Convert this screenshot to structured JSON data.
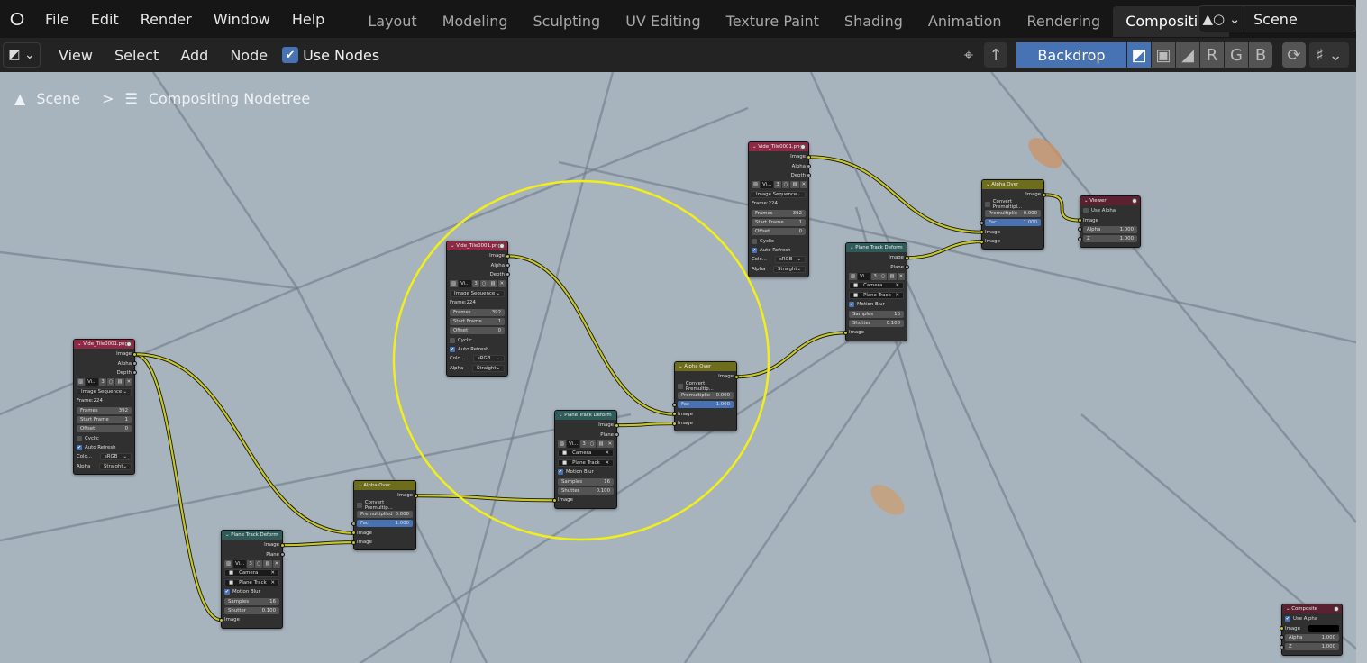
{
  "topbar": {
    "menus": [
      "File",
      "Edit",
      "Render",
      "Window",
      "Help"
    ],
    "workspaces": [
      "Layout",
      "Modeling",
      "Sculpting",
      "UV Editing",
      "Texture Paint",
      "Shading",
      "Animation",
      "Rendering",
      "Compositing"
    ],
    "active_workspace": "Compositing",
    "scene": "Scene"
  },
  "toolbar": {
    "menus": [
      "View",
      "Select",
      "Add",
      "Node"
    ],
    "use_nodes_label": "Use Nodes",
    "use_nodes_checked": true,
    "backdrop_label": "Backdrop",
    "channels": [
      "R",
      "G",
      "B"
    ]
  },
  "breadcrumb": {
    "scene": "Scene",
    "separator": ">",
    "nodetree": "Compositing Nodetree"
  },
  "colors": {
    "image_header": "#8c2a45",
    "alphaover_header": "#6d6d1c",
    "planetrack_header": "#2f5c5a",
    "output_header": "#5b2130",
    "link": "#c7c729",
    "annotation_circle": "#f2ee1a",
    "accent": "#4772b3"
  },
  "nodes": [
    {
      "id": "img1",
      "type": "image",
      "title": "Vide_Tile0001.png",
      "rows": [
        {
          "t": "out",
          "label": "Image",
          "s": "y"
        },
        {
          "t": "out",
          "label": "Alpha",
          "s": "g"
        },
        {
          "t": "out",
          "label": "Depth",
          "s": "g"
        },
        {
          "t": "imgbar",
          "name": "Vi...",
          "users": "3"
        },
        {
          "t": "select",
          "value": "Image Sequence"
        },
        {
          "t": "text",
          "label": "Frame:224"
        },
        {
          "t": "field",
          "label": "Frames",
          "value": "392"
        },
        {
          "t": "field",
          "label": "Start Frame",
          "value": "1"
        },
        {
          "t": "field",
          "label": "Offset",
          "value": "0"
        },
        {
          "t": "check",
          "label": "Cyclic",
          "checked": false
        },
        {
          "t": "check",
          "label": "Auto Refresh",
          "checked": true
        },
        {
          "t": "lselect",
          "label": "Colo...",
          "value": "sRGB"
        },
        {
          "t": "lselect",
          "label": "Alpha",
          "value": "Straight"
        }
      ]
    },
    {
      "id": "img2",
      "type": "image",
      "title": "Vide_Tile0001.png",
      "rows": [
        {
          "t": "out",
          "label": "Image",
          "s": "y"
        },
        {
          "t": "out",
          "label": "Alpha",
          "s": "g"
        },
        {
          "t": "out",
          "label": "Depth",
          "s": "g"
        },
        {
          "t": "imgbar",
          "name": "Vi...",
          "users": "3"
        },
        {
          "t": "select",
          "value": "Image Sequence"
        },
        {
          "t": "text",
          "label": "Frame:224"
        },
        {
          "t": "field",
          "label": "Frames",
          "value": "392"
        },
        {
          "t": "field",
          "label": "Start Frame",
          "value": "1"
        },
        {
          "t": "field",
          "label": "Offset",
          "value": "0"
        },
        {
          "t": "check",
          "label": "Cyclic",
          "checked": false
        },
        {
          "t": "check",
          "label": "Auto Refresh",
          "checked": true
        },
        {
          "t": "lselect",
          "label": "Colo...",
          "value": "sRGB"
        },
        {
          "t": "lselect",
          "label": "Alpha",
          "value": "Straight"
        }
      ]
    },
    {
      "id": "img3",
      "type": "image",
      "title": "Vide_Tile0001.png",
      "rows": [
        {
          "t": "out",
          "label": "Image",
          "s": "y"
        },
        {
          "t": "out",
          "label": "Alpha",
          "s": "g"
        },
        {
          "t": "out",
          "label": "Depth",
          "s": "g"
        },
        {
          "t": "imgbar",
          "name": "Vi...",
          "users": "3"
        },
        {
          "t": "select",
          "value": "Image Sequence"
        },
        {
          "t": "text",
          "label": "Frame:224"
        },
        {
          "t": "field",
          "label": "Frames",
          "value": "392"
        },
        {
          "t": "field",
          "label": "Start Frame",
          "value": "1"
        },
        {
          "t": "field",
          "label": "Offset",
          "value": "0"
        },
        {
          "t": "check",
          "label": "Cyclic",
          "checked": false
        },
        {
          "t": "check",
          "label": "Auto Refresh",
          "checked": true
        },
        {
          "t": "lselect",
          "label": "Colo...",
          "value": "sRGB"
        },
        {
          "t": "lselect",
          "label": "Alpha",
          "value": "Straight"
        }
      ]
    },
    {
      "id": "ptd1",
      "type": "planetrack",
      "title": "Plane Track Deform",
      "rows": [
        {
          "t": "out",
          "label": "Image",
          "s": "y"
        },
        {
          "t": "out",
          "label": "Plane",
          "s": "g"
        },
        {
          "t": "imgbar",
          "name": "Vi...",
          "users": "3"
        },
        {
          "t": "block",
          "value": "Camera"
        },
        {
          "t": "block",
          "value": "Plane Track"
        },
        {
          "t": "check",
          "label": "Motion Blur",
          "checked": true
        },
        {
          "t": "field",
          "label": "Samples",
          "value": "16"
        },
        {
          "t": "field",
          "label": "Shutter",
          "value": "0.100"
        },
        {
          "t": "in",
          "label": "Image",
          "s": "y"
        }
      ]
    },
    {
      "id": "ptd2",
      "type": "planetrack",
      "title": "Plane Track Deform",
      "rows": [
        {
          "t": "out",
          "label": "Image",
          "s": "y"
        },
        {
          "t": "out",
          "label": "Plane",
          "s": "g"
        },
        {
          "t": "imgbar",
          "name": "Vi...",
          "users": "3"
        },
        {
          "t": "block",
          "value": "Camera"
        },
        {
          "t": "block",
          "value": "Plane Track"
        },
        {
          "t": "check",
          "label": "Motion Blur",
          "checked": true
        },
        {
          "t": "field",
          "label": "Samples",
          "value": "16"
        },
        {
          "t": "field",
          "label": "Shutter",
          "value": "0.100"
        },
        {
          "t": "in",
          "label": "Image",
          "s": "y"
        }
      ]
    },
    {
      "id": "ptd3",
      "type": "planetrack",
      "title": "Plane Track Deform",
      "rows": [
        {
          "t": "out",
          "label": "Image",
          "s": "y"
        },
        {
          "t": "out",
          "label": "Plane",
          "s": "g"
        },
        {
          "t": "imgbar",
          "name": "Vi...",
          "users": "3"
        },
        {
          "t": "block",
          "value": "Camera"
        },
        {
          "t": "block",
          "value": "Plane Track"
        },
        {
          "t": "check",
          "label": "Motion Blur",
          "checked": true
        },
        {
          "t": "field",
          "label": "Samples",
          "value": "16"
        },
        {
          "t": "field",
          "label": "Shutter",
          "value": "0.100"
        },
        {
          "t": "in",
          "label": "Image",
          "s": "y"
        }
      ]
    },
    {
      "id": "ao1",
      "type": "alphaover",
      "title": "Alpha Over",
      "rows": [
        {
          "t": "out",
          "label": "Image",
          "s": "y"
        },
        {
          "t": "check",
          "label": "Convert Premultip...",
          "checked": false
        },
        {
          "t": "field",
          "label": "Premultiplied",
          "value": "0.000"
        },
        {
          "t": "fac",
          "label": "Fac",
          "value": "1.000"
        },
        {
          "t": "in",
          "label": "Image",
          "s": "y"
        },
        {
          "t": "in",
          "label": "Image",
          "s": "y"
        }
      ]
    },
    {
      "id": "ao2",
      "type": "alphaover",
      "title": "Alpha Over",
      "rows": [
        {
          "t": "out",
          "label": "Image",
          "s": "y"
        },
        {
          "t": "check",
          "label": "Convert Premultip...",
          "checked": false
        },
        {
          "t": "field",
          "label": "Premultiplie",
          "value": "0.000"
        },
        {
          "t": "fac",
          "label": "Fac",
          "value": "1.000"
        },
        {
          "t": "in",
          "label": "Image",
          "s": "y"
        },
        {
          "t": "in",
          "label": "Image",
          "s": "y"
        }
      ]
    },
    {
      "id": "ao3",
      "type": "alphaover",
      "title": "Alpha Over",
      "rows": [
        {
          "t": "out",
          "label": "Image",
          "s": "y"
        },
        {
          "t": "check",
          "label": "Convert Premultipl...",
          "checked": false
        },
        {
          "t": "field",
          "label": "Premultiplie",
          "value": "0.000"
        },
        {
          "t": "fac",
          "label": "Fac",
          "value": "1.000"
        },
        {
          "t": "in",
          "label": "Image",
          "s": "y"
        },
        {
          "t": "in",
          "label": "Image",
          "s": "y"
        }
      ]
    },
    {
      "id": "viewer",
      "type": "output",
      "title": "Viewer",
      "rows": [
        {
          "t": "check",
          "label": "Use Alpha",
          "checked": false
        },
        {
          "t": "in",
          "label": "Image",
          "s": "y"
        },
        {
          "t": "infield",
          "label": "Alpha",
          "value": "1.000"
        },
        {
          "t": "infield",
          "label": "Z",
          "value": "1.000"
        }
      ]
    },
    {
      "id": "composite",
      "type": "output",
      "title": "Composite",
      "rows": [
        {
          "t": "check",
          "label": "Use Alpha",
          "checked": true
        },
        {
          "t": "inblack",
          "label": "Image"
        },
        {
          "t": "infield",
          "label": "Alpha",
          "value": "1.000"
        },
        {
          "t": "infield",
          "label": "Z",
          "value": "1.000"
        }
      ]
    }
  ],
  "links": [
    {
      "from": [
        "img1",
        0
      ],
      "to": [
        "ptd1",
        8
      ]
    },
    {
      "from": [
        "img1",
        0
      ],
      "to": [
        "ao1",
        4
      ]
    },
    {
      "from": [
        "ptd1",
        0
      ],
      "to": [
        "ao1",
        5
      ]
    },
    {
      "from": [
        "ao1",
        0
      ],
      "to": [
        "ptd2",
        8
      ]
    },
    {
      "from": [
        "img2",
        0
      ],
      "to": [
        "ao2",
        4
      ]
    },
    {
      "from": [
        "ptd2",
        0
      ],
      "to": [
        "ao2",
        5
      ]
    },
    {
      "from": [
        "ao2",
        0
      ],
      "to": [
        "ptd3",
        8
      ]
    },
    {
      "from": [
        "img3",
        0
      ],
      "to": [
        "ao3",
        4
      ]
    },
    {
      "from": [
        "ptd3",
        0
      ],
      "to": [
        "ao3",
        5
      ]
    },
    {
      "from": [
        "ao3",
        0
      ],
      "to": [
        "viewer",
        1
      ]
    }
  ]
}
